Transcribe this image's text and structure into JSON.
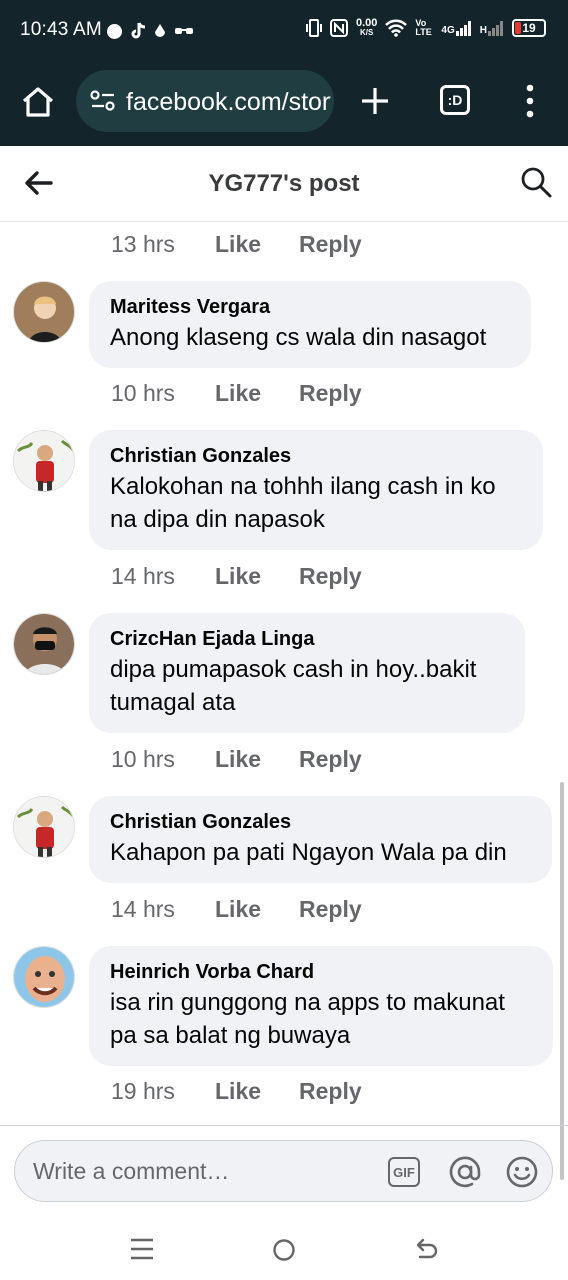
{
  "status_bar": {
    "time": "10:43 AM",
    "net_speed_top": "0.00",
    "net_speed_unit": "K/S",
    "volte": "Vo LTE",
    "signal_1": "4G",
    "signal_2": "H",
    "battery": "19"
  },
  "browser": {
    "url": "facebook.com/story",
    "tabs_label": ":D"
  },
  "header": {
    "title": "YG777's post"
  },
  "actions": {
    "like": "Like",
    "reply": "Reply"
  },
  "first_meta": {
    "time": "13 hrs"
  },
  "comments": [
    {
      "name": "Maritess Vergara",
      "lines": [
        "Anong klaseng cs wala din nasagot"
      ],
      "time": "10 hrs"
    },
    {
      "name": "Christian Gonzales",
      "lines": [
        "Kalokohan na tohhh ilang cash in ko",
        "na dipa din napasok"
      ],
      "time": "14 hrs"
    },
    {
      "name": "CrizcHan Ejada Linga",
      "lines": [
        "dipa pumapasok cash in hoy..bakit",
        "tumagal ata"
      ],
      "time": "10 hrs"
    },
    {
      "name": "Christian Gonzales",
      "lines": [
        "Kahapon pa pati Ngayon Wala pa din"
      ],
      "time": "14 hrs"
    },
    {
      "name": "Heinrich Vorba Chard",
      "lines": [
        "isa rin gunggong na apps to makunat",
        "pa sa balat ng buwaya"
      ],
      "time": "19 hrs"
    }
  ],
  "composer": {
    "placeholder": "Write a comment…",
    "gif_label": "GIF"
  },
  "colors": {
    "browser_bar": "#13252b",
    "url_pill": "#203d42",
    "bubble": "#f0f2f5",
    "meta_text": "#65676b"
  }
}
